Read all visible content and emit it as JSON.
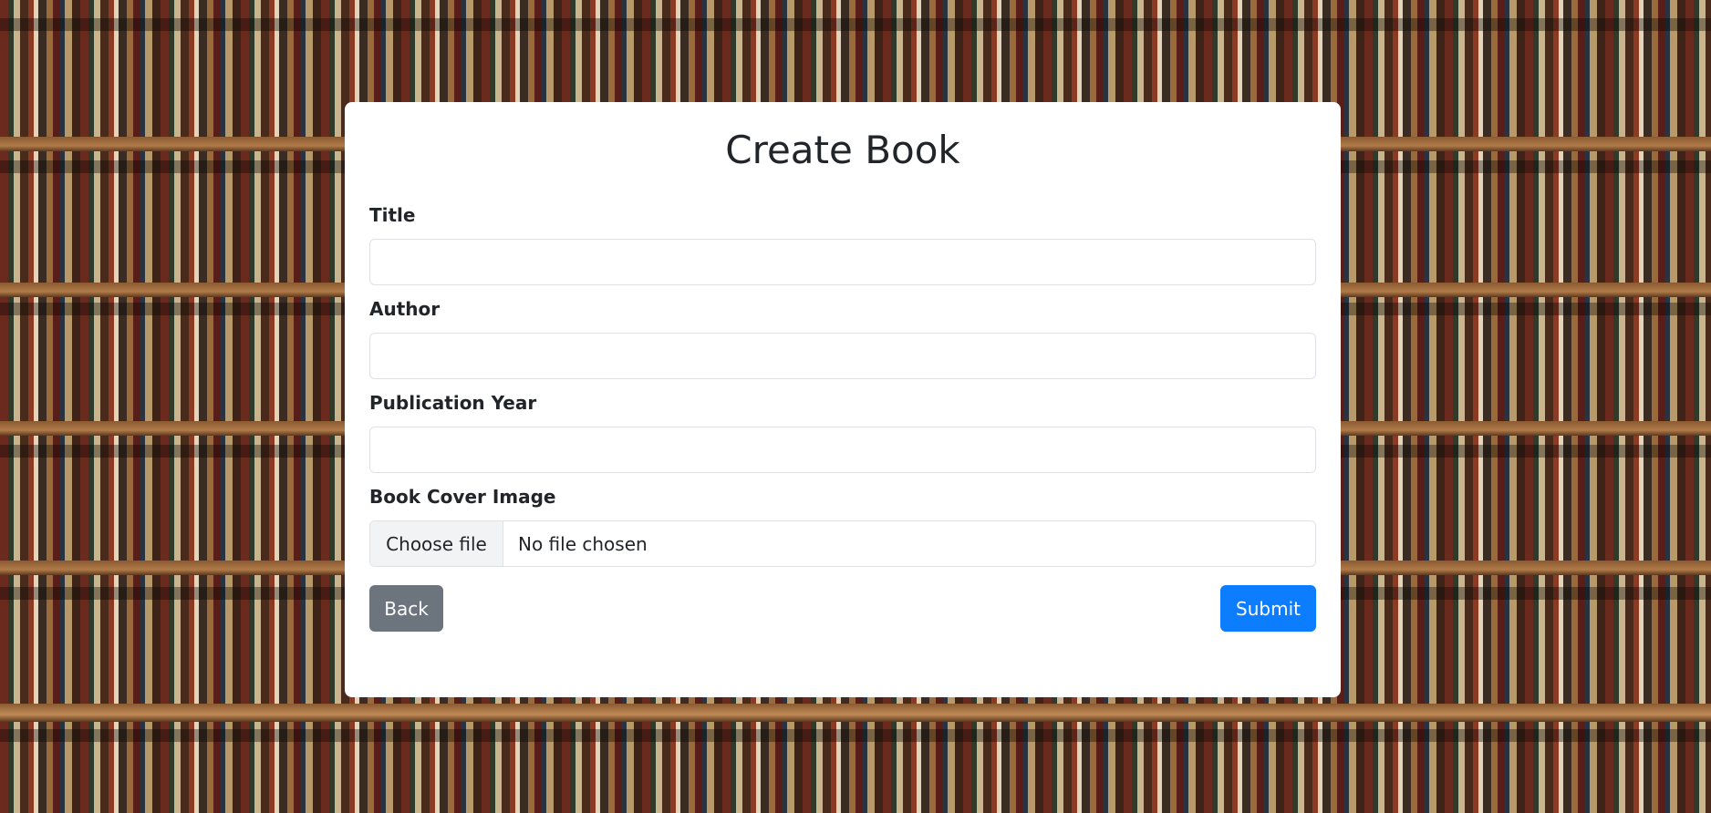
{
  "form": {
    "title": "Create Book",
    "fields": {
      "title": {
        "label": "Title",
        "value": ""
      },
      "author": {
        "label": "Author",
        "value": ""
      },
      "publication_year": {
        "label": "Publication Year",
        "value": ""
      },
      "cover_image": {
        "label": "Book Cover Image",
        "button_label": "Choose file",
        "status": "No file chosen"
      }
    },
    "back_label": "Back",
    "submit_label": "Submit"
  },
  "colors": {
    "back_button": "#6c757d",
    "submit_button": "#0d7dff",
    "card_background": "#ffffff"
  }
}
